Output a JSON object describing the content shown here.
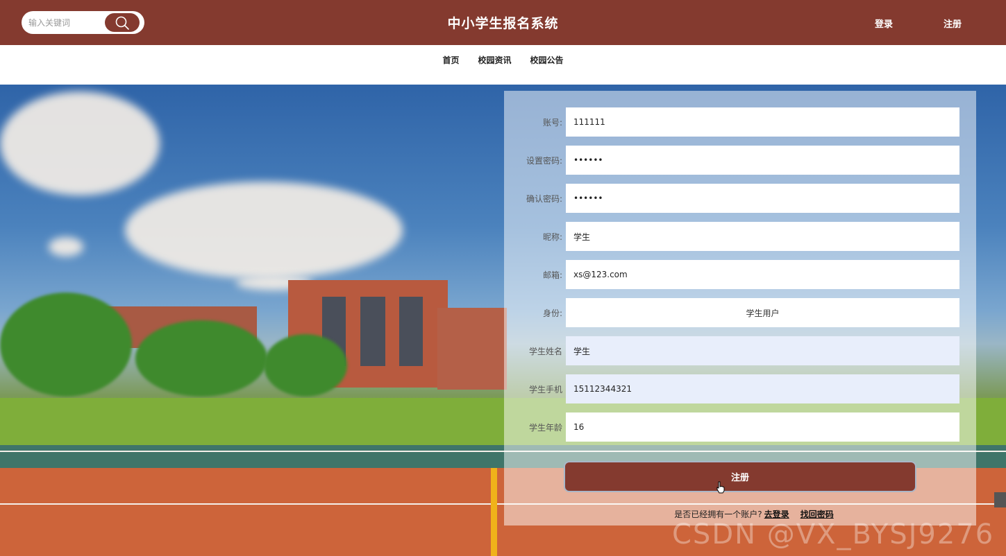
{
  "header": {
    "search_placeholder": "输入关键词",
    "title": "中小学生报名系统",
    "login_label": "登录",
    "register_label": "注册"
  },
  "nav": {
    "items": [
      {
        "label": "首页"
      },
      {
        "label": "校园资讯"
      },
      {
        "label": "校园公告"
      }
    ]
  },
  "form": {
    "account": {
      "label": "账号:",
      "value": "111111"
    },
    "password": {
      "label": "设置密码:",
      "value": "••••••"
    },
    "confirm_password": {
      "label": "确认密码:",
      "value": "••••••"
    },
    "nickname": {
      "label": "昵称:",
      "value": "学生"
    },
    "email": {
      "label": "邮箱:",
      "value": "xs@123.com"
    },
    "identity": {
      "label": "身份:",
      "value": "学生用户"
    },
    "student_name": {
      "label": "学生姓名",
      "value": "学生"
    },
    "student_phone": {
      "label": "学生手机",
      "value": "15112344321"
    },
    "student_age": {
      "label": "学生年龄",
      "value": "16"
    },
    "submit_label": "注册",
    "has_account_text": "是否已经拥有一个账户?",
    "go_login_label": "去登录",
    "find_password_label": "找回密码"
  },
  "watermark": "CSDN @VX_BYSJ9276",
  "colors": {
    "brand": "#843a2f",
    "panel": "rgba(255,255,255,0.5)"
  }
}
